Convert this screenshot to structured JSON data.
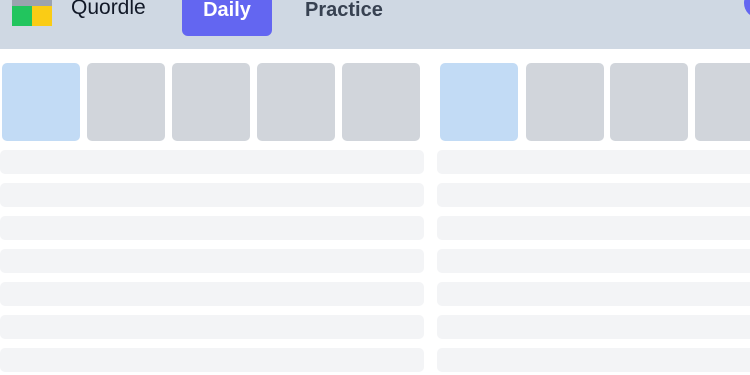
{
  "header": {
    "app_title": "Quordle",
    "tabs": [
      {
        "label": "Daily",
        "active": true
      },
      {
        "label": "Practice",
        "active": false
      }
    ],
    "colors": {
      "bar": "#cfd8e3",
      "active_tab": "#6366f1"
    }
  },
  "logo": {
    "icon": "quordle-logo-icon",
    "colors": [
      "#9ca3af",
      "#9ca3af",
      "#22c55e",
      "#facc15"
    ]
  },
  "boards": [
    {
      "name": "board-1",
      "tiles": [
        {
          "state": "active"
        },
        {
          "state": "empty"
        },
        {
          "state": "empty"
        },
        {
          "state": "empty"
        },
        {
          "state": "empty"
        }
      ],
      "guess_rows": 7
    },
    {
      "name": "board-2",
      "tiles": [
        {
          "state": "active"
        },
        {
          "state": "empty"
        },
        {
          "state": "empty"
        },
        {
          "state": "empty"
        }
      ],
      "guess_rows": 7
    }
  ],
  "colors": {
    "tile_active": "#c2dbf5",
    "tile_empty": "#d1d5db",
    "row_placeholder": "#f3f4f6"
  }
}
